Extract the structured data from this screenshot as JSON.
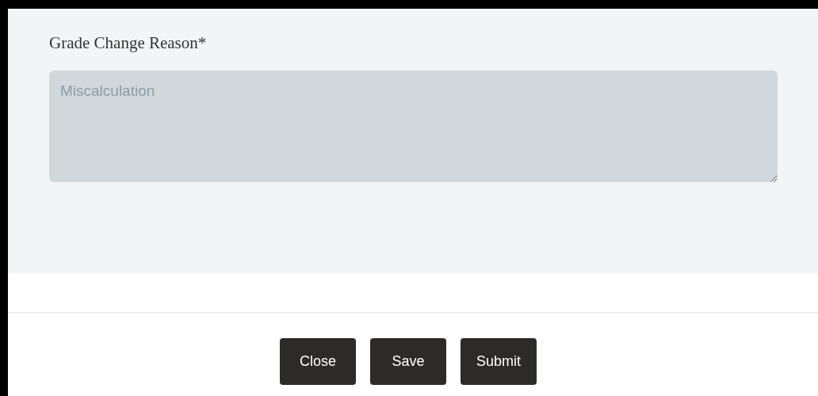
{
  "form": {
    "field": {
      "label": "Grade Change Reason*",
      "value": "Miscalculation",
      "disabled": true
    }
  },
  "buttons": [
    {
      "label": "Close"
    },
    {
      "label": "Save"
    },
    {
      "label": "Submit"
    }
  ]
}
